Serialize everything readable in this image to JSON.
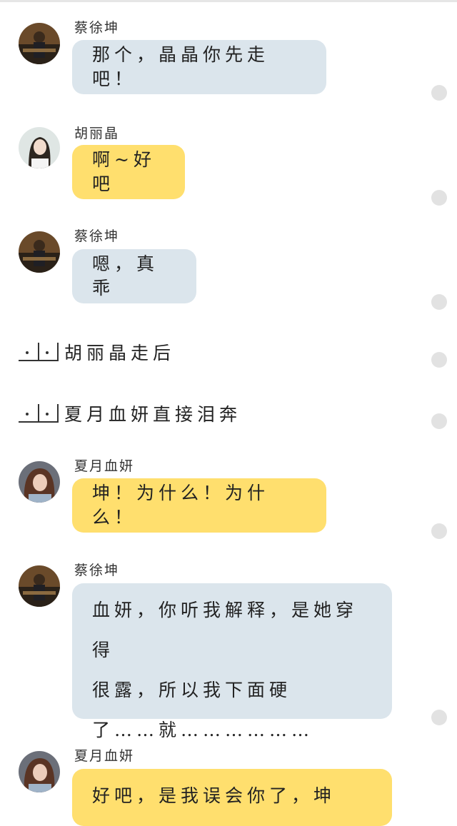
{
  "chat": {
    "messages": [
      {
        "sender": "蔡徐坤",
        "avatar": "cai-xukun-avatar",
        "bubble_color": "#dbe5ec",
        "lines": [
          "那个，晶晶你先走吧！"
        ]
      },
      {
        "sender": "胡丽晶",
        "avatar": "hu-lijing-avatar",
        "bubble_color": "#ffdf6e",
        "lines": [
          "啊~好吧"
        ]
      },
      {
        "sender": "蔡徐坤",
        "avatar": "cai-xukun-avatar",
        "bubble_color": "#dbe5ec",
        "lines": [
          "嗯，真乖"
        ]
      },
      {
        "sender": "夏月血妍",
        "avatar": "xia-yuexueyan-avatar",
        "bubble_color": "#ffdf6e",
        "lines": [
          "坤！为什么！为什么！"
        ]
      },
      {
        "sender": "蔡徐坤",
        "avatar": "cai-xukun-avatar",
        "bubble_color": "#dbe5ec",
        "lines": [
          "血妍，你听我解释，是她穿得",
          "很露，所以我下面硬",
          "了……就………………"
        ]
      },
      {
        "sender": "夏月血妍",
        "avatar": "xia-yuexueyan-avatar",
        "bubble_color": "#ffdf6e",
        "lines": [
          "好吧，是我误会你了，坤"
        ]
      }
    ],
    "narrations": [
      {
        "text": "胡丽晶走后"
      },
      {
        "text": "夏月血妍直接泪奔"
      }
    ]
  }
}
